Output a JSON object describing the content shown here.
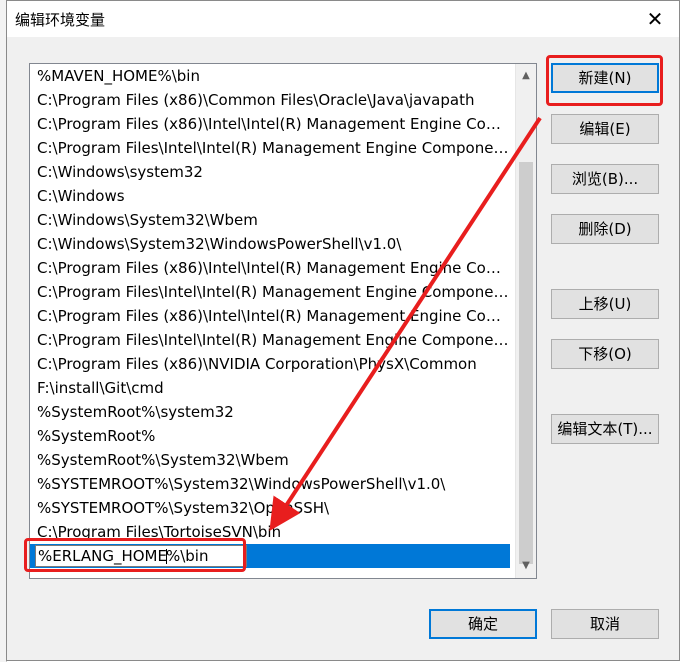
{
  "dialog": {
    "title": "编辑环境变量",
    "close_glyph": "✕"
  },
  "list": {
    "items": [
      "%MAVEN_HOME%\\bin",
      "C:\\Program Files (x86)\\Common Files\\Oracle\\Java\\javapath",
      "C:\\Program Files (x86)\\Intel\\Intel(R) Management Engine Comp...",
      "C:\\Program Files\\Intel\\Intel(R) Management Engine Componen...",
      "C:\\Windows\\system32",
      "C:\\Windows",
      "C:\\Windows\\System32\\Wbem",
      "C:\\Windows\\System32\\WindowsPowerShell\\v1.0\\",
      "C:\\Program Files (x86)\\Intel\\Intel(R) Management Engine Comp...",
      "C:\\Program Files\\Intel\\Intel(R) Management Engine Componen...",
      "C:\\Program Files (x86)\\Intel\\Intel(R) Management Engine Comp...",
      "C:\\Program Files\\Intel\\Intel(R) Management Engine Componen...",
      "C:\\Program Files (x86)\\NVIDIA Corporation\\PhysX\\Common",
      "F:\\install\\Git\\cmd",
      "%SystemRoot%\\system32",
      "%SystemRoot%",
      "%SystemRoot%\\System32\\Wbem",
      "%SYSTEMROOT%\\System32\\WindowsPowerShell\\v1.0\\",
      "%SYSTEMROOT%\\System32\\OpenSSH\\",
      "C:\\Program Files\\TortoiseSVN\\bin"
    ],
    "editing_value_before_caret": "%ERLANG_HOME",
    "editing_value_after_caret": "%\\bin",
    "scroll_up_glyph": "▲",
    "scroll_down_glyph": "▼"
  },
  "buttons": {
    "new": "新建(N)",
    "edit": "编辑(E)",
    "browse": "浏览(B)...",
    "delete": "删除(D)",
    "move_up": "上移(U)",
    "move_down": "下移(O)",
    "edit_text": "编辑文本(T)...",
    "ok": "确定",
    "cancel": "取消"
  },
  "colors": {
    "selection": "#0078d7",
    "annotation": "#e81e1e"
  }
}
